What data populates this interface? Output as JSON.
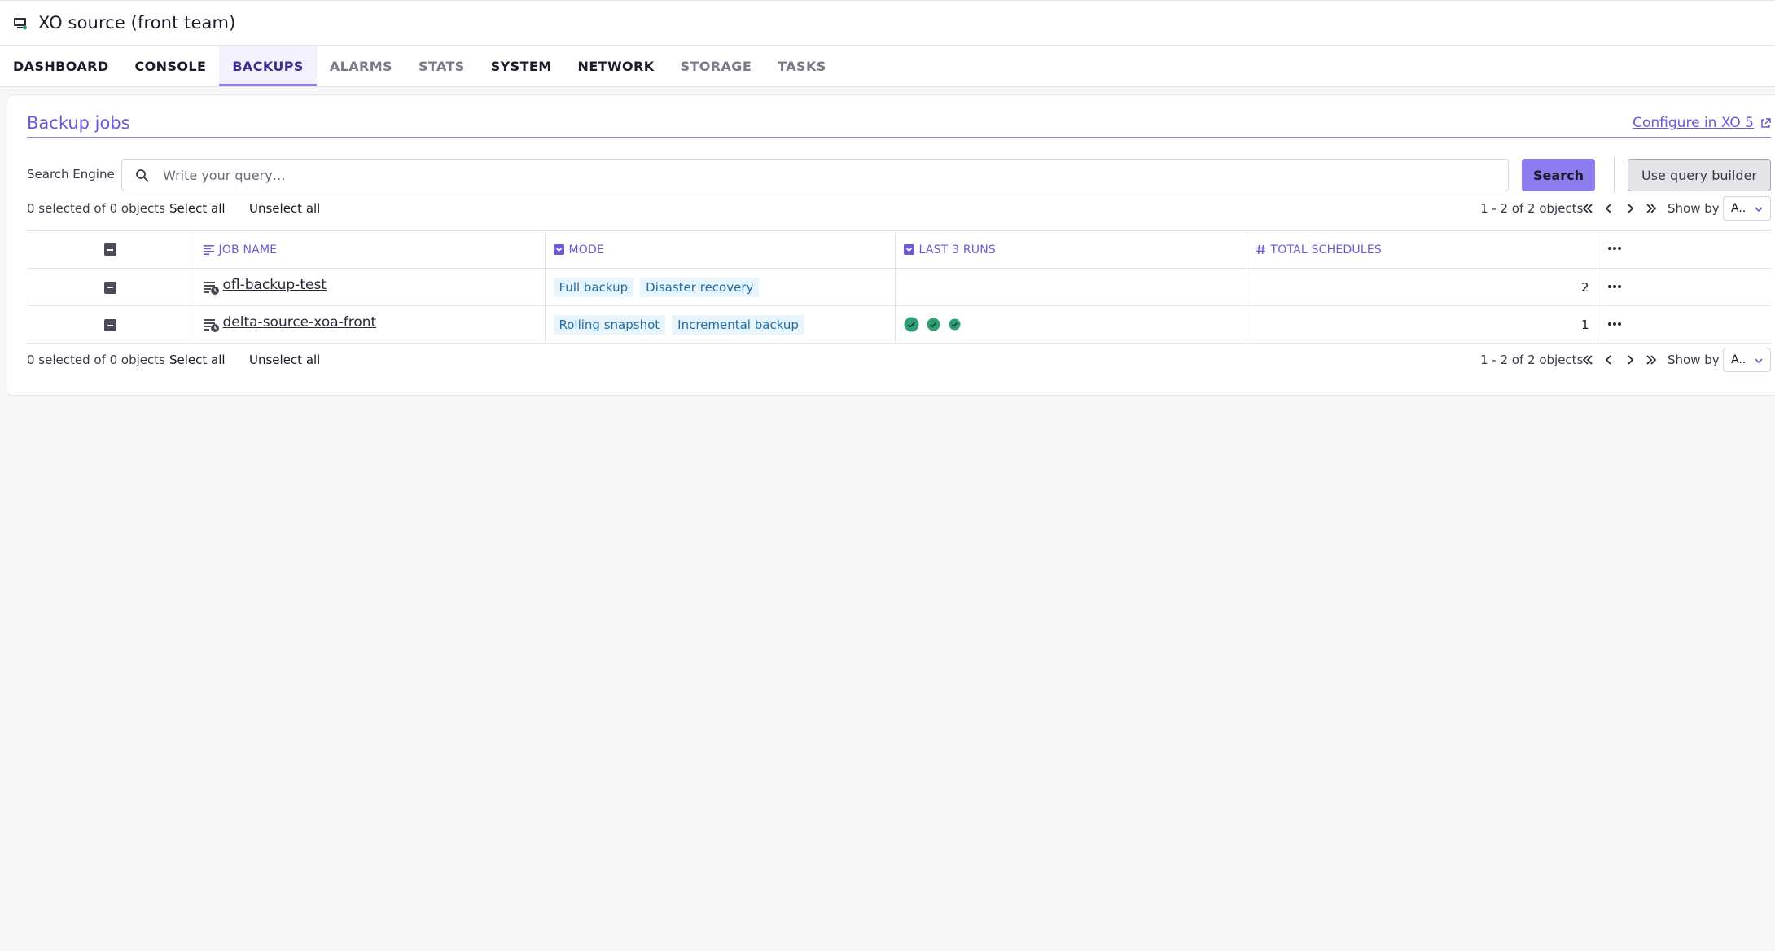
{
  "header": {
    "title": "XO source (front team)"
  },
  "tabs": [
    {
      "label": "DASHBOARD"
    },
    {
      "label": "CONSOLE"
    },
    {
      "label": "BACKUPS"
    },
    {
      "label": "ALARMS"
    },
    {
      "label": "STATS"
    },
    {
      "label": "SYSTEM"
    },
    {
      "label": "NETWORK"
    },
    {
      "label": "STORAGE"
    },
    {
      "label": "TASKS"
    }
  ],
  "card": {
    "title": "Backup jobs",
    "config_link": "Configure in XO 5"
  },
  "search": {
    "label": "Search Engine",
    "placeholder": "Write your query…",
    "button": "Search",
    "query_builder": "Use query builder"
  },
  "selection": {
    "count": "0 selected of 0 objects",
    "select_all": "Select all",
    "unselect_all": "Unselect all",
    "pagination": "1 - 2 of 2 objects",
    "show_by": "Show by",
    "show_by_value": "A.."
  },
  "table": {
    "columns": {
      "job_name": "JOB NAME",
      "mode": "MODE",
      "last_runs": "LAST 3 RUNS",
      "total_schedules": "TOTAL SCHEDULES"
    },
    "rows": [
      {
        "name": "ofl-backup-test",
        "modes": [
          "Full backup",
          "Disaster recovery"
        ],
        "runs": [],
        "schedules": "2"
      },
      {
        "name": "delta-source-xoa-front",
        "modes": [
          "Rolling snapshot",
          "Incremental backup"
        ],
        "runs": [
          "success",
          "success",
          "success"
        ],
        "schedules": "1"
      }
    ]
  }
}
